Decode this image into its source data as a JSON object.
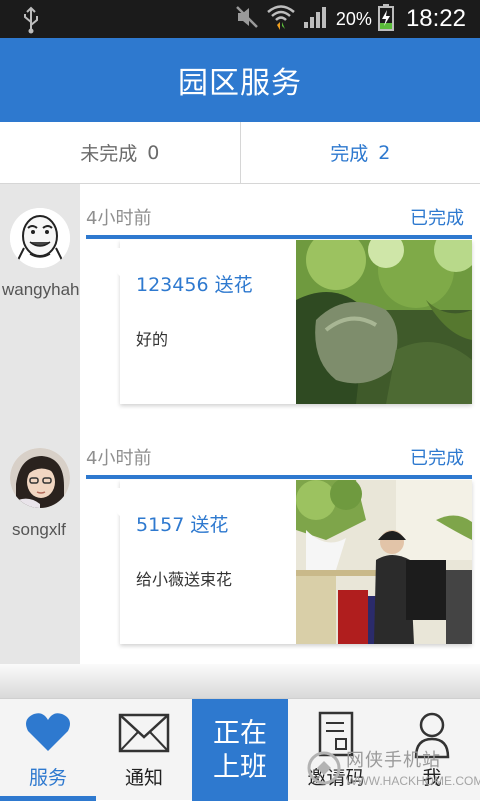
{
  "status_bar": {
    "battery_percent": "20%",
    "time": "18:22",
    "icons": [
      "usb-icon",
      "mute-icon",
      "wifi-icon",
      "signal-icon",
      "battery-charging-icon"
    ]
  },
  "header": {
    "title": "园区服务"
  },
  "tabs": [
    {
      "label": "未完成",
      "count": "0",
      "active": false
    },
    {
      "label": "完成",
      "count": "2",
      "active": true
    }
  ],
  "entries": [
    {
      "username": "wangyhah",
      "time_ago": "4小时前",
      "status": "已完成",
      "title": "123456 送花",
      "body": "好的",
      "avatar_icon": "meme-face-avatar",
      "photo": "forest-rock-photo"
    },
    {
      "username": "songxlf",
      "time_ago": "4小时前",
      "status": "已完成",
      "title": "5157 送花",
      "body": "给小薇送束花",
      "avatar_icon": "girl-portrait-avatar",
      "photo": "office-desk-photo"
    }
  ],
  "bottom_nav": [
    {
      "label": "服务",
      "icon": "heart-icon",
      "active": true
    },
    {
      "label": "通知",
      "icon": "envelope-icon",
      "active": false
    },
    {
      "label": "正在\n上班",
      "icon": "",
      "active": false
    },
    {
      "label": "邀请码",
      "icon": "document-icon",
      "active": false
    },
    {
      "label": "我",
      "icon": "person-icon",
      "active": false
    }
  ],
  "watermark": {
    "text": "网侠手机站",
    "url": "WWW.HACKHOME.COM"
  },
  "colors": {
    "primary": "#2e79cf",
    "statusbar": "#1b1b1b",
    "sidebar": "#e6e6e6"
  }
}
